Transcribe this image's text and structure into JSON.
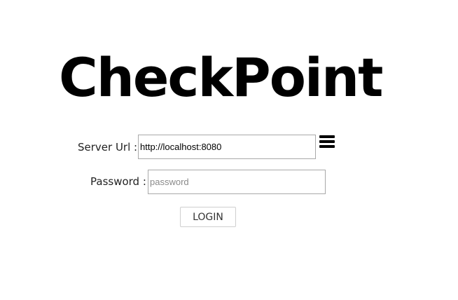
{
  "app": {
    "title": "CheckPoint"
  },
  "login_form": {
    "server_url_label": "Server Url :",
    "server_url_value": "http://localhost:8080",
    "password_label": "Password :",
    "password_value": "",
    "password_placeholder": "password",
    "login_button_label": "LOGIN"
  },
  "icons": {
    "menu": "menu-icon"
  }
}
